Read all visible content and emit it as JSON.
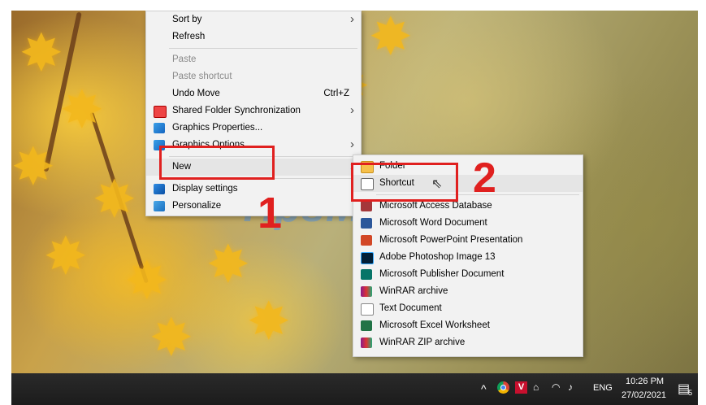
{
  "context_menu": {
    "items": [
      {
        "label": "Sort by",
        "submenu": true
      },
      {
        "label": "Refresh"
      },
      {
        "label": "Paste",
        "disabled": true
      },
      {
        "label": "Paste shortcut",
        "disabled": true
      },
      {
        "label": "Undo Move",
        "shortcut": "Ctrl+Z"
      },
      {
        "label": "Shared Folder Synchronization",
        "icon": "shared-folder-sync-icon",
        "submenu": true
      },
      {
        "label": "Graphics Properties...",
        "icon": "graphics-properties-icon"
      },
      {
        "label": "Graphics Options",
        "icon": "graphics-options-icon",
        "submenu": true
      },
      {
        "label": "New",
        "submenu": true
      },
      {
        "label": "Display settings",
        "icon": "display-settings-icon"
      },
      {
        "label": "Personalize",
        "icon": "personalize-icon"
      }
    ]
  },
  "new_submenu": {
    "items": [
      {
        "label": "Folder",
        "icon": "folder-icon"
      },
      {
        "label": "Shortcut",
        "icon": "shortcut-icon"
      },
      {
        "label": "Microsoft Access Database",
        "icon": "access-icon"
      },
      {
        "label": "Microsoft Word Document",
        "icon": "word-icon"
      },
      {
        "label": "Microsoft PowerPoint Presentation",
        "icon": "powerpoint-icon"
      },
      {
        "label": "Adobe Photoshop Image 13",
        "icon": "photoshop-icon"
      },
      {
        "label": "Microsoft Publisher Document",
        "icon": "publisher-icon"
      },
      {
        "label": "WinRAR archive",
        "icon": "winrar-icon"
      },
      {
        "label": "Text Document",
        "icon": "text-document-icon"
      },
      {
        "label": "Microsoft Excel Worksheet",
        "icon": "excel-icon"
      },
      {
        "label": "WinRAR ZIP archive",
        "icon": "winrar-zip-icon"
      }
    ]
  },
  "annotations": {
    "step1": "1",
    "step2": "2",
    "watermark": "TipsMake"
  },
  "taskbar": {
    "tray_up": "^",
    "tray_v": "V",
    "language": "ENG",
    "time": "10:26 PM",
    "date": "27/02/2021",
    "notification_count": "5"
  },
  "colors": {
    "annotation_red": "#e0201f",
    "menu_bg": "#f2f2f2",
    "taskbar": "#1c1c1c"
  }
}
